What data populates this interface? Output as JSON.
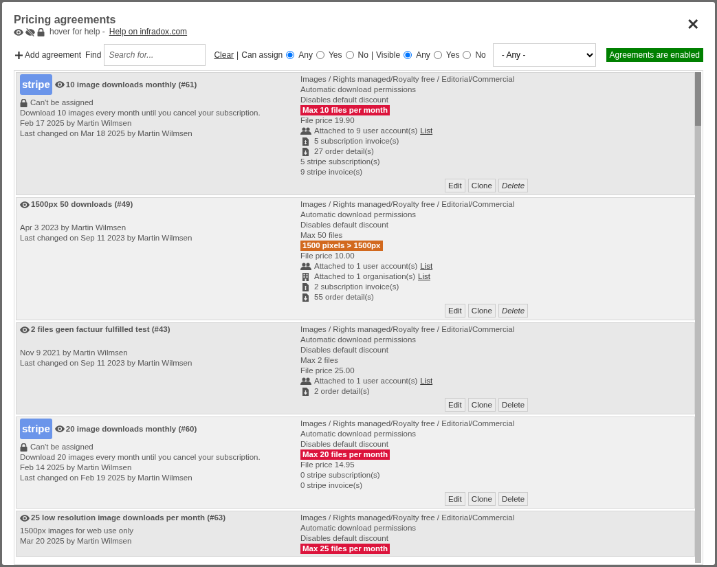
{
  "dialog": {
    "title": "Pricing agreements",
    "help_text": "hover for help -",
    "help_link": "Help on infradox.com",
    "close": "✕"
  },
  "toolbar": {
    "add": "Add agreement",
    "find_label": "Find",
    "search_placeholder": "Search for...",
    "clear": "Clear",
    "separator": "|",
    "can_assign": {
      "label": "Can assign",
      "options": [
        {
          "label": "Any",
          "selected": true
        },
        {
          "label": "Yes",
          "selected": false
        },
        {
          "label": "No",
          "selected": false
        }
      ]
    },
    "visible": {
      "label": "Visible",
      "options": [
        {
          "label": "Any",
          "selected": true
        },
        {
          "label": "Yes",
          "selected": false
        },
        {
          "label": "No",
          "selected": false
        }
      ]
    },
    "select_value": "- Any -",
    "status": "Agreements are enabled"
  },
  "agreements": [
    {
      "stripe": "stripe",
      "title": "10 image downloads monthly (#61)",
      "locked": "Can't be assigned",
      "details": [
        "Download 10 images every month until you cancel your subscription.",
        "Feb 17 2025 by Martin Wilmsen",
        "Last changed on Mar 18 2025 by Martin Wilmsen"
      ],
      "lines": [
        {
          "kind": "text",
          "text": "Images /  Rights managed/Royalty free /  Editorial/Commercial"
        },
        {
          "kind": "text",
          "text": "Automatic download permissions"
        },
        {
          "kind": "text",
          "text": "Disables default discount"
        },
        {
          "kind": "badge",
          "text": "Max 10 files per month",
          "color": "#dc143c"
        },
        {
          "kind": "text",
          "text": "File price 19.90"
        },
        {
          "kind": "users",
          "text": "Attached to 9 user account(s)",
          "link": "List"
        },
        {
          "kind": "invoice",
          "text": "5 subscription invoice(s)"
        },
        {
          "kind": "download",
          "text": "27 order detail(s)"
        },
        {
          "kind": "text",
          "text": "5 stripe subscription(s)"
        },
        {
          "kind": "text",
          "text": "9 stripe invoice(s)"
        }
      ],
      "buttons": [
        {
          "label": "Edit",
          "italic": false
        },
        {
          "label": "Clone",
          "italic": false
        },
        {
          "label": "Delete",
          "italic": true
        }
      ]
    },
    {
      "title": "1500px 50 downloads (#49)",
      "details": [
        "Apr 3 2023 by Martin Wilmsen",
        "Last changed on Sep 11 2023 by Martin Wilmsen"
      ],
      "lines": [
        {
          "kind": "text",
          "text": "Images /  Rights managed/Royalty free /  Editorial/Commercial"
        },
        {
          "kind": "text",
          "text": "Automatic download permissions"
        },
        {
          "kind": "text",
          "text": "Disables default discount"
        },
        {
          "kind": "text",
          "text": "Max 50 files"
        },
        {
          "kind": "badge",
          "text": "1500 pixels > 1500px",
          "color": "#d2691e"
        },
        {
          "kind": "text",
          "text": "File price 10.00"
        },
        {
          "kind": "users",
          "text": "Attached to 1 user account(s)",
          "link": "List"
        },
        {
          "kind": "building",
          "text": "Attached to 1 organisation(s)",
          "link": "List"
        },
        {
          "kind": "invoice",
          "text": "2 subscription invoice(s)"
        },
        {
          "kind": "download",
          "text": "55 order detail(s)"
        }
      ],
      "buttons": [
        {
          "label": "Edit",
          "italic": false
        },
        {
          "label": "Clone",
          "italic": false
        },
        {
          "label": "Delete",
          "italic": true
        }
      ]
    },
    {
      "title": "2 files geen factuur fulfilled test (#43)",
      "details": [
        "Nov 9 2021 by Martin Wilmsen",
        "Last changed on Sep 11 2023 by Martin Wilmsen"
      ],
      "lines": [
        {
          "kind": "text",
          "text": "Images /  Rights managed/Royalty free /  Editorial/Commercial"
        },
        {
          "kind": "text",
          "text": "Automatic download permissions"
        },
        {
          "kind": "text",
          "text": "Disables default discount"
        },
        {
          "kind": "text",
          "text": "Max 2 files"
        },
        {
          "kind": "text",
          "text": "File price 25.00"
        },
        {
          "kind": "users",
          "text": "Attached to 1 user account(s)",
          "link": "List"
        },
        {
          "kind": "download",
          "text": "2 order detail(s)"
        }
      ],
      "buttons": [
        {
          "label": "Edit",
          "italic": false
        },
        {
          "label": "Clone",
          "italic": false
        },
        {
          "label": "Delete",
          "italic": false
        }
      ]
    },
    {
      "stripe": "stripe",
      "title": "20 image downloads monthly (#60)",
      "locked": "Can't be assigned",
      "details": [
        "Download 20 images every month until you cancel your subscription.",
        "Feb 14 2025 by Martin Wilmsen",
        "Last changed on Feb 19 2025 by Martin Wilmsen"
      ],
      "lines": [
        {
          "kind": "text",
          "text": "Images /  Rights managed/Royalty free /  Editorial/Commercial"
        },
        {
          "kind": "text",
          "text": "Automatic download permissions"
        },
        {
          "kind": "text",
          "text": "Disables default discount"
        },
        {
          "kind": "badge",
          "text": "Max 20 files per month",
          "color": "#dc143c"
        },
        {
          "kind": "text",
          "text": "File price 14.95"
        },
        {
          "kind": "text",
          "text": "0 stripe subscription(s)"
        },
        {
          "kind": "text",
          "text": "0 stripe invoice(s)"
        }
      ],
      "buttons": [
        {
          "label": "Edit",
          "italic": false
        },
        {
          "label": "Clone",
          "italic": false
        },
        {
          "label": "Delete",
          "italic": false
        }
      ]
    },
    {
      "title": "25 low resolution image downloads per month (#63)",
      "details": [
        "1500px images for web use only",
        "Mar 20 2025 by Martin Wilmsen"
      ],
      "lines": [
        {
          "kind": "text",
          "text": "Images /  Rights managed/Royalty free /  Editorial/Commercial"
        },
        {
          "kind": "text",
          "text": "Automatic download permissions"
        },
        {
          "kind": "text",
          "text": "Disables default discount"
        },
        {
          "kind": "badge",
          "text": "Max 25 files per month",
          "color": "#dc143c"
        }
      ]
    }
  ]
}
